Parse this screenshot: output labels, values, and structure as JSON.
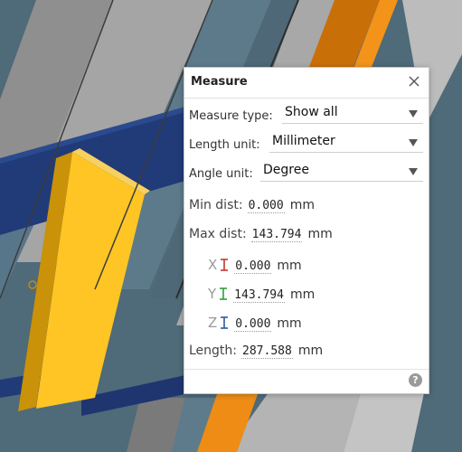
{
  "panel": {
    "title": "Measure",
    "measure_type": {
      "label": "Measure type:",
      "value": "Show all"
    },
    "length_unit": {
      "label": "Length unit:",
      "value": "Millimeter"
    },
    "angle_unit": {
      "label": "Angle unit:",
      "value": "Degree"
    },
    "min_dist": {
      "label": "Min dist:",
      "value": "0.000",
      "unit": "mm"
    },
    "max_dist": {
      "label": "Max dist:",
      "value": "143.794",
      "unit": "mm"
    },
    "x": {
      "label": "X",
      "value": "0.000",
      "unit": "mm",
      "color": "#c0392b"
    },
    "y": {
      "label": "Y",
      "value": "143.794",
      "unit": "mm",
      "color": "#2e9e3e"
    },
    "z": {
      "label": "Z",
      "value": "0.000",
      "unit": "mm",
      "color": "#2c5aa0"
    },
    "length": {
      "label": "Length:",
      "value": "287.588",
      "unit": "mm"
    },
    "help_glyph": "?"
  },
  "colors": {
    "navy": "#1f3570",
    "yellow": "#ffc425",
    "orange": "#ed8a12",
    "slate": "#5e7b8b",
    "gray": "#a6a6a6"
  }
}
